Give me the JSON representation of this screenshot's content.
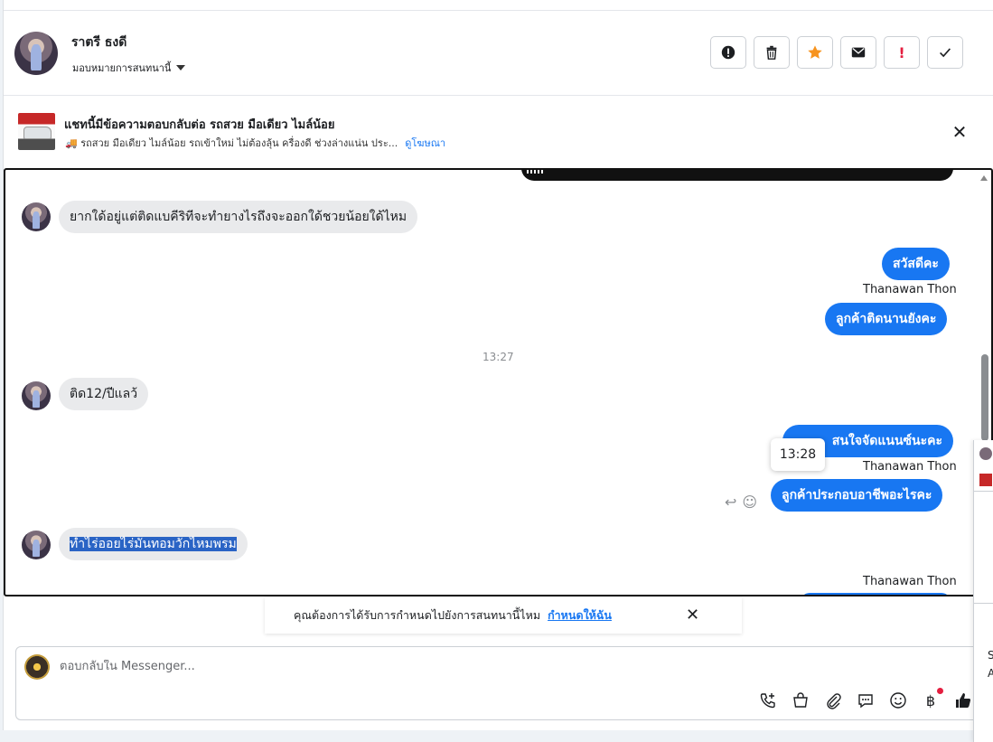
{
  "contact": {
    "name": "ราตรี ธงดี",
    "assign_label": "มอบหมายการสนทนานี้"
  },
  "actions": [
    {
      "name": "spam-button",
      "icon": "alert-circle-icon"
    },
    {
      "name": "delete-button",
      "icon": "trash-icon"
    },
    {
      "name": "star-button",
      "icon": "star-icon"
    },
    {
      "name": "mark-unread-button",
      "icon": "envelope-icon"
    },
    {
      "name": "follow-up-button",
      "icon": "exclamation-icon"
    },
    {
      "name": "done-button",
      "icon": "check-icon"
    }
  ],
  "ad": {
    "title": "แชทนี้มีข้อความตอบกลับต่อ รถสวย มือเดียว ไมล์น้อย",
    "subtitle": "🚚 รถสวย มือเดียว ไมล์น้อย รถเข้าใหม่ ไม่ต้องลุ้น ครื่องดี ช่วงล่างแน่น ประ...",
    "link": "ดูโฆษณา"
  },
  "messages": {
    "m1": "ยากใด้อยู่แต่ติดแบคีริทีจะทำยางไรถึงจะออกใด้ชวยน้อยใด้ไหม",
    "m2": "สวัสดีคะ",
    "sender1": "Thanawan Thon",
    "m3": "ลูกค้าติดนานยังคะ",
    "time1": "13:27",
    "m4": "ติด12/ปีแลว้",
    "m5": "สนใจจัดแนนซ์นะคะ",
    "tooltip_time": "13:28",
    "sender2": "Thanawan Thon",
    "m6": "ลูกค้าประกอบอาชีพอะไรคะ",
    "m7": "ทำไร่ออยไร่มันทอมวักไหมพรม",
    "sender3": "Thanawan Thon"
  },
  "assign_banner": {
    "text": "คุณต้องการได้รับการกำหนดไปยังการสนทนานี้ไหม",
    "link": "กำหนดให้ฉัน"
  },
  "composer": {
    "placeholder": "ตอบกลับใน Messenger..."
  },
  "tools": [
    "call-icon",
    "shop-bag-icon",
    "paperclip-icon",
    "chat-bubble-icon",
    "emoji-icon",
    "baht-icon",
    "thumbs-up-icon"
  ],
  "side": {
    "t1": "S",
    "t2": "A"
  },
  "colors": {
    "accent": "#1877f2",
    "star": "#f7931e",
    "alert": "#e41e3f"
  }
}
